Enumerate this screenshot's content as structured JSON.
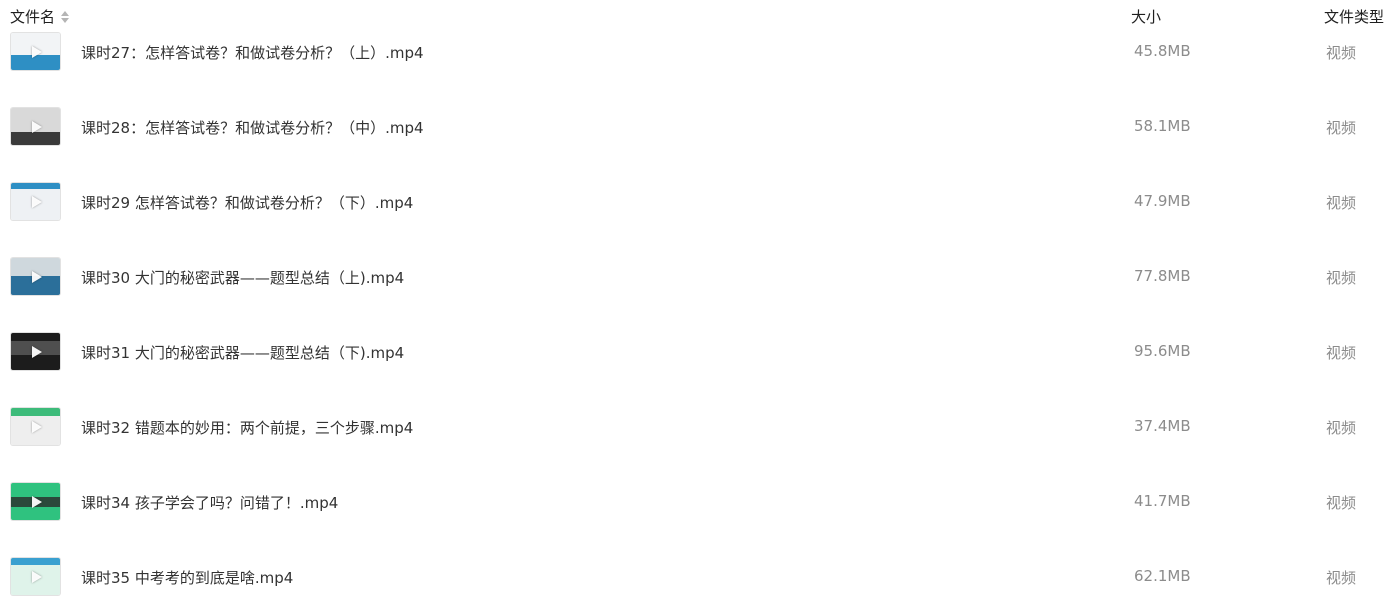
{
  "header": {
    "name_label": "文件名",
    "size_label": "大小",
    "type_label": "文件类型"
  },
  "files": [
    {
      "name": "课时27：怎样答试卷？和做试卷分析？（上）.mp4",
      "size": "45.8MB",
      "type": "视频",
      "thumb": {
        "bg": "#f2f4f6",
        "band": "#2e8fc4"
      }
    },
    {
      "name": "课时28：怎样答试卷？和做试卷分析？（中）.mp4",
      "size": "58.1MB",
      "type": "视频",
      "thumb": {
        "bg": "#d9d9d9",
        "band": "#3a3a3a"
      }
    },
    {
      "name": "课时29 怎样答试卷？和做试卷分析？（下）.mp4",
      "size": "47.9MB",
      "type": "视频",
      "thumb": {
        "bg": "#eef1f4",
        "band": "#2e8fc4"
      }
    },
    {
      "name": "课时30 大门的秘密武器——题型总结（上).mp4",
      "size": "77.8MB",
      "type": "视频",
      "thumb": {
        "bg": "#cfd8dd",
        "band": "#2b6f9a"
      }
    },
    {
      "name": "课时31 大门的秘密武器——题型总结（下).mp4",
      "size": "95.6MB",
      "type": "视频",
      "thumb": {
        "bg": "#1c1c1c",
        "band": "#e8e8e8"
      }
    },
    {
      "name": "课时32 错题本的妙用：两个前提，三个步骤.mp4",
      "size": "37.4MB",
      "type": "视频",
      "thumb": {
        "bg": "#eeeeee",
        "band": "#3dbb7a"
      }
    },
    {
      "name": "课时34 孩子学会了吗？问错了！.mp4",
      "size": "41.7MB",
      "type": "视频",
      "thumb": {
        "bg": "#2fc27f",
        "band": "#2a2a2a"
      }
    },
    {
      "name": "课时35 中考考的到底是啥.mp4",
      "size": "62.1MB",
      "type": "视频",
      "thumb": {
        "bg": "#dff3ea",
        "band": "#3aa0d0"
      }
    }
  ]
}
